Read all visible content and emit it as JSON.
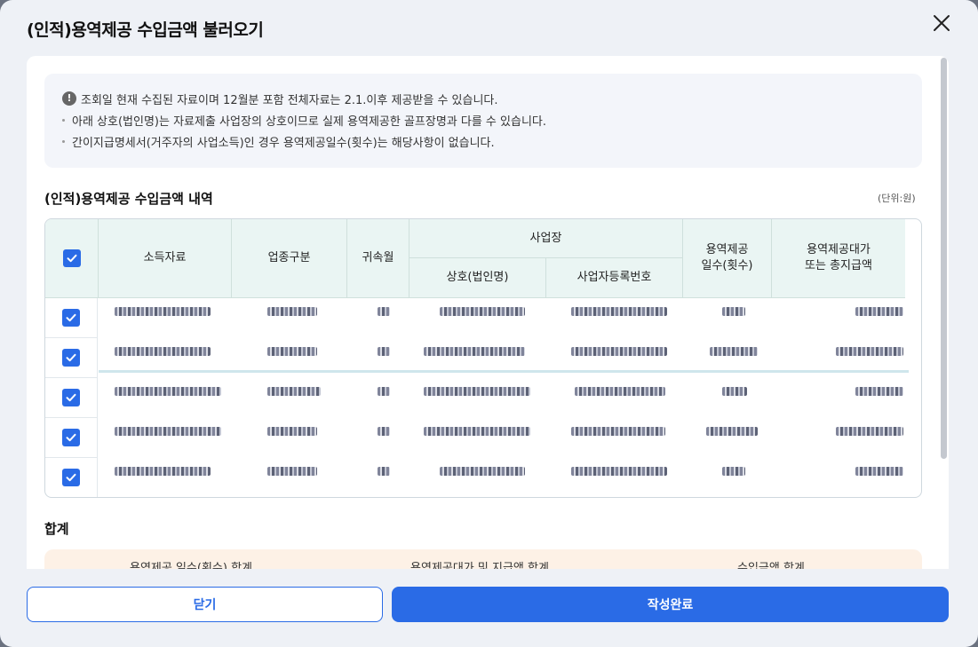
{
  "modal": {
    "title": "(인적)용역제공 수입금액 불러오기",
    "close_icon": "close-icon"
  },
  "notice": {
    "lines": [
      "조회일 현재 수집된 자료이며 12월분 포함 전체자료는 2.1.이후 제공받을 수 있습니다.",
      "아래 상호(법인명)는 자료제출 사업장의 상호이므로 실제 용역제공한 골프장명과 다를 수 있습니다.",
      "간이지급명세서(거주자의 사업소득)인 경우 용역제공일수(횟수)는 해당사항이 없습니다."
    ]
  },
  "section": {
    "title": "(인적)용역제공 수입금액 내역",
    "unit": "(단위:원)"
  },
  "table": {
    "headers": {
      "income_source": "소득자료",
      "business_type": "업종구분",
      "period": "귀속월",
      "workplace": "사업장",
      "trade_name": "상호(법인명)",
      "biz_number": "사업자등록번호",
      "service_days_1": "용역제공",
      "service_days_2": "일수(횟수)",
      "total_amount_1": "용역제공대가",
      "total_amount_2": "또는 총지급액"
    },
    "rows_checked": [
      true,
      true,
      true,
      true,
      true
    ]
  },
  "totals": {
    "title": "합계",
    "labels": [
      "용역제공 일수(횟수) 합계",
      "용역제공대가 및 지급액 합계",
      "수입금액 합계"
    ]
  },
  "footer": {
    "close_label": "닫기",
    "done_label": "작성완료"
  },
  "colors": {
    "primary": "#2a6be6",
    "header_bg": "#eaf5f3",
    "total_bg": "#fdf1e6"
  }
}
